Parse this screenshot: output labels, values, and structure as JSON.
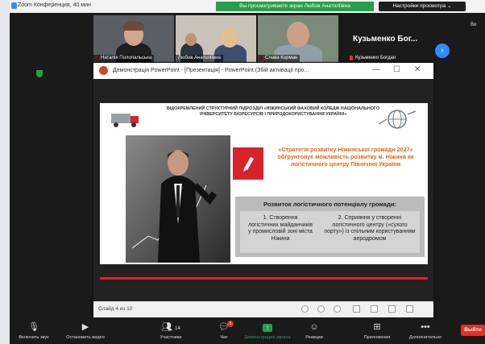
{
  "window": {
    "title": "Zoom Конференция, 40 мин"
  },
  "banner": {
    "share_text": "Вы просматриваете экран Любов Анатоліївна",
    "view_options": "Настройки просмотра ⌄"
  },
  "participants": [
    {
      "name": "Наталія Полопальська"
    },
    {
      "name": "Любов Анатоліївна"
    },
    {
      "name": "Слава Корман"
    },
    {
      "name": "Кузьменко Богдан",
      "display": "Кузьменко Бог..."
    }
  ],
  "sidebar_right": {
    "label": "Ви"
  },
  "ppt": {
    "title": "Демонстрація PowerPoint - [Презентація] - PowerPoint (Збій активації про...",
    "status": "Слайд 4 из 10",
    "window_controls": {
      "minimize": "—",
      "maximize": "☐",
      "close": "✕"
    }
  },
  "slide": {
    "header": "ВІДОКРЕМЛЕНИЙ СТРУКТУРНИЙ ПІДРОЗДІЛ «НІЖИНСЬКИЙ ФАХОВИЙ КОЛЕДЖ НАЦІОНАЛЬНОГО УНІВЕРСИТЕТУ БІОРЕСУРСІВ І ПРИРОДОКОРИСТУВАННЯ УКРАЇНИ»",
    "strategy_text": "«Стратегія розвитку Ніжинської громади 2027» обґрунтовує можливість розвитку м. Ніжина як логістичного центру Північної України",
    "box_title": "Розвиток логістичного потенціалу громади:",
    "item1": "1. Створення логістичних майданчиків у промисловій зоні міста Ніжина",
    "item2": "2. Сприяння у створенні логістичного центру («сухого порту») із спільним користуванням аеродромом"
  },
  "toolbar": {
    "mute": "Включить звук",
    "video": "Остановить видео",
    "participants": "Участники",
    "participants_count": "14",
    "chat": "Чат",
    "chat_badge": "1",
    "share": "Демонстрация экрана",
    "reactions": "Реакции",
    "apps": "Приложения",
    "more": "Дополнительно",
    "leave": "Выйти"
  },
  "colors": {
    "zoom_blue": "#2d8cff",
    "share_green": "#24a148",
    "slide_red": "#d9232a",
    "strategy_orange": "#e5650f"
  }
}
